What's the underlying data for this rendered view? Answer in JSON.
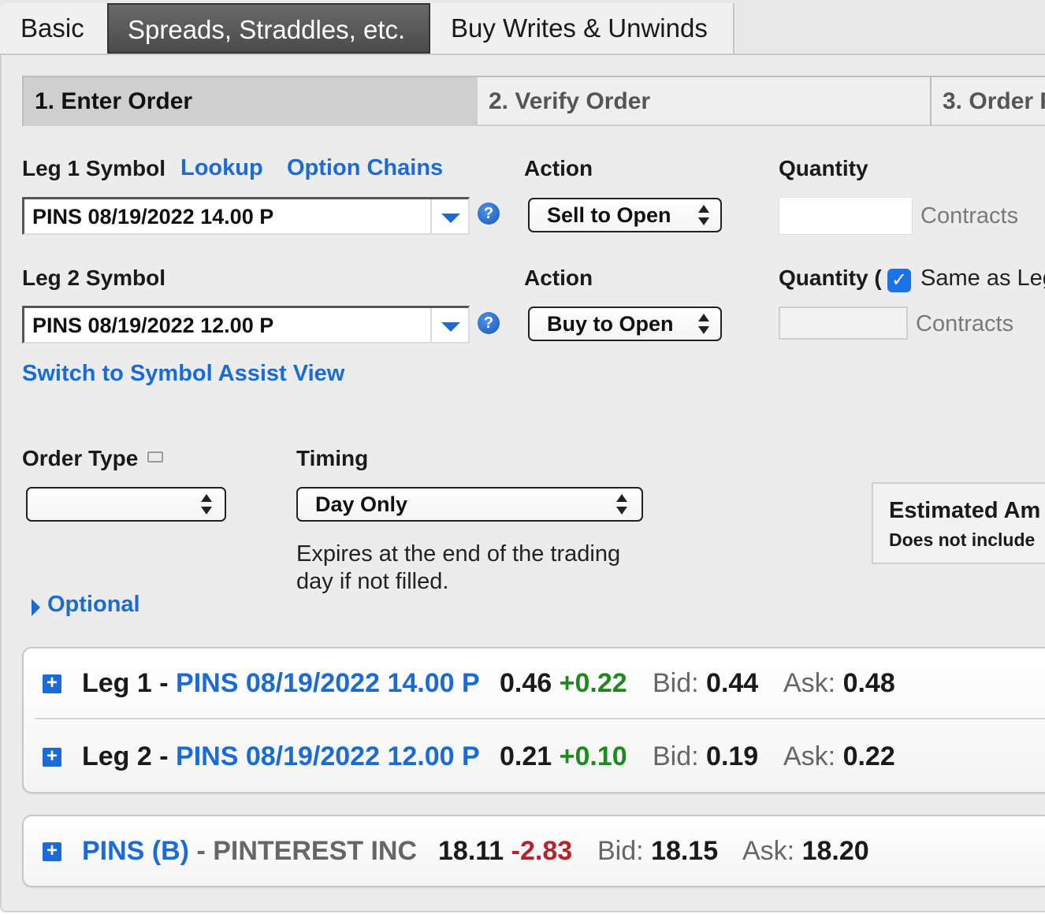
{
  "tabs": [
    "Basic",
    "Spreads, Straddles, etc.",
    "Buy Writes & Unwinds"
  ],
  "steps": [
    "1. Enter Order",
    "2. Verify Order",
    "3. Order F"
  ],
  "leg1": {
    "label": "Leg 1 Symbol",
    "lookup": "Lookup",
    "option_chains": "Option Chains",
    "symbol": "PINS 08/19/2022 14.00 P",
    "action_label": "Action",
    "action": "Sell to Open",
    "quantity_label": "Quantity",
    "quantity_value": "",
    "contracts": "Contracts"
  },
  "leg2": {
    "label": "Leg 2 Symbol",
    "symbol": "PINS 08/19/2022 12.00 P",
    "action_label": "Action",
    "action": "Buy to Open",
    "quantity_label": "Quantity (",
    "same_as": "Same as Leg",
    "same_as_checked": true,
    "quantity_value": "",
    "contracts": "Contracts"
  },
  "switch_view": "Switch to Symbol Assist View",
  "order_type": {
    "label": "Order Type",
    "value": ""
  },
  "timing": {
    "label": "Timing",
    "value": "Day Only",
    "desc_line1": "Expires at the end of the trading",
    "desc_line2": "day if not filled."
  },
  "estimate": {
    "title": "Estimated Am",
    "note": "Does not include"
  },
  "optional": "Optional",
  "quotes": [
    {
      "prefix": "Leg 1 - ",
      "symbol": "PINS 08/19/2022 14.00 P",
      "last": "0.46",
      "change": "+0.22",
      "bid_label": "Bid:",
      "bid": "0.44",
      "ask_label": "Ask:",
      "ask": "0.48"
    },
    {
      "prefix": "Leg 2 - ",
      "symbol": "PINS 08/19/2022 12.00 P",
      "last": "0.21",
      "change": "+0.10",
      "bid_label": "Bid:",
      "bid": "0.19",
      "ask_label": "Ask:",
      "ask": "0.22"
    }
  ],
  "underlying": {
    "symbol": "PINS (B)",
    "name": " - PINTEREST INC",
    "last": "18.11",
    "change": "-2.83",
    "bid_label": "Bid:",
    "bid": "18.15",
    "ask_label": "Ask:",
    "ask": "18.20"
  },
  "colors": {
    "link": "#1a6bd6",
    "positive": "#1e8a1e",
    "negative": "#b8222a"
  }
}
